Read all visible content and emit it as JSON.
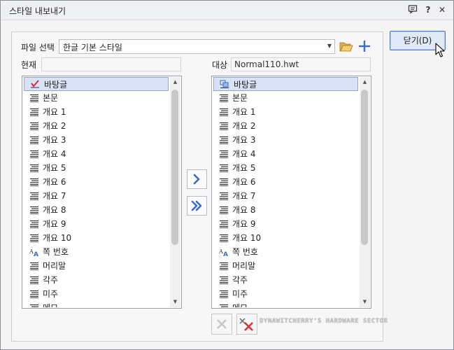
{
  "window": {
    "title": "스타일 내보내기",
    "help_label": "?",
    "close_label": "✕"
  },
  "form": {
    "file_select_label": "파일 선택",
    "file_select_value": "한글 기본 스타일",
    "current_label": "현재",
    "current_value": "",
    "target_label": "대상",
    "target_value": "Normal110.hwt"
  },
  "left_list": {
    "items": [
      {
        "label": "바탕글",
        "icon": "check-paragraph-icon",
        "selected": true
      },
      {
        "label": "본문",
        "icon": "paragraph-style-icon"
      },
      {
        "label": "개요 1",
        "icon": "paragraph-style-icon"
      },
      {
        "label": "개요 2",
        "icon": "paragraph-style-icon"
      },
      {
        "label": "개요 3",
        "icon": "paragraph-style-icon"
      },
      {
        "label": "개요 4",
        "icon": "paragraph-style-icon"
      },
      {
        "label": "개요 5",
        "icon": "paragraph-style-icon"
      },
      {
        "label": "개요 6",
        "icon": "paragraph-style-icon"
      },
      {
        "label": "개요 7",
        "icon": "paragraph-style-icon"
      },
      {
        "label": "개요 8",
        "icon": "paragraph-style-icon"
      },
      {
        "label": "개요 9",
        "icon": "paragraph-style-icon"
      },
      {
        "label": "개요 10",
        "icon": "paragraph-style-icon"
      },
      {
        "label": "쪽 번호",
        "icon": "character-style-icon"
      },
      {
        "label": "머리말",
        "icon": "paragraph-style-icon"
      },
      {
        "label": "각주",
        "icon": "paragraph-style-icon"
      },
      {
        "label": "미주",
        "icon": "paragraph-style-icon"
      },
      {
        "label": "메모",
        "icon": "paragraph-style-icon"
      }
    ]
  },
  "right_list": {
    "items": [
      {
        "label": "바탕글",
        "icon": "linked-paragraph-icon",
        "selected": true
      },
      {
        "label": "본문",
        "icon": "paragraph-style-icon"
      },
      {
        "label": "개요 1",
        "icon": "paragraph-style-icon"
      },
      {
        "label": "개요 2",
        "icon": "paragraph-style-icon"
      },
      {
        "label": "개요 3",
        "icon": "paragraph-style-icon"
      },
      {
        "label": "개요 4",
        "icon": "paragraph-style-icon"
      },
      {
        "label": "개요 5",
        "icon": "paragraph-style-icon"
      },
      {
        "label": "개요 6",
        "icon": "paragraph-style-icon"
      },
      {
        "label": "개요 7",
        "icon": "paragraph-style-icon"
      },
      {
        "label": "개요 8",
        "icon": "paragraph-style-icon"
      },
      {
        "label": "개요 9",
        "icon": "paragraph-style-icon"
      },
      {
        "label": "개요 10",
        "icon": "paragraph-style-icon"
      },
      {
        "label": "쪽 번호",
        "icon": "character-style-icon"
      },
      {
        "label": "머리말",
        "icon": "paragraph-style-icon"
      },
      {
        "label": "각주",
        "icon": "paragraph-style-icon"
      },
      {
        "label": "미주",
        "icon": "paragraph-style-icon"
      },
      {
        "label": "메모",
        "icon": "paragraph-style-icon"
      }
    ]
  },
  "buttons": {
    "close_label": "닫기(D)",
    "copy_icon": "chevron-right-icon",
    "copy_all_icon": "double-chevron-right-icon",
    "delete_icon": "delete-x-icon",
    "delete_all_icon": "delete-all-icon"
  },
  "watermark": "DYNAWITCHERRY'S HARDWARE SECTOR",
  "colors": {
    "accent": "#4b7ac7",
    "selection": "#d9e3f5",
    "icon_blue": "#3a6cc8",
    "delete_red": "#d33434"
  }
}
